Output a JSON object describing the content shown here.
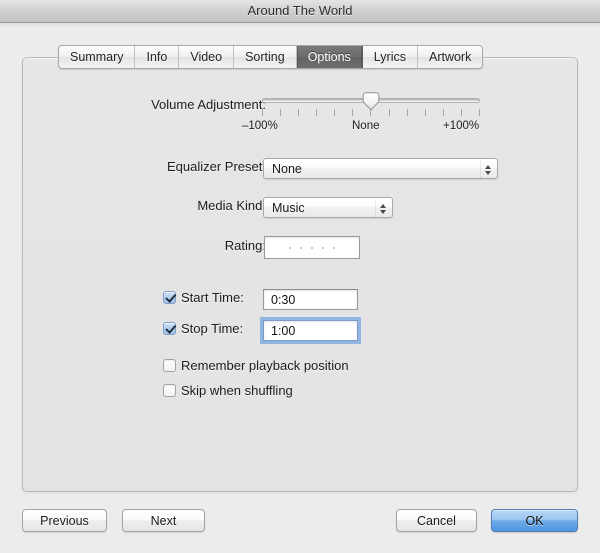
{
  "window": {
    "title": "Around The World"
  },
  "tabs": [
    {
      "label": "Summary",
      "selected": false
    },
    {
      "label": "Info",
      "selected": false
    },
    {
      "label": "Video",
      "selected": false
    },
    {
      "label": "Sorting",
      "selected": false
    },
    {
      "label": "Options",
      "selected": true
    },
    {
      "label": "Lyrics",
      "selected": false
    },
    {
      "label": "Artwork",
      "selected": false
    }
  ],
  "form": {
    "volume": {
      "label": "Volume Adjustment:",
      "min_label": "–100%",
      "center_label": "None",
      "max_label": "+100%",
      "value_percent": 0,
      "tick_count": 13
    },
    "equalizer": {
      "label": "Equalizer Preset:",
      "value": "None"
    },
    "media_kind": {
      "label": "Media Kind:",
      "value": "Music"
    },
    "rating": {
      "label": "Rating:",
      "stars": 0,
      "star_slots": 5
    },
    "start_time": {
      "label": "Start Time:",
      "value": "0:30",
      "checked": true,
      "focused": false
    },
    "stop_time": {
      "label": "Stop Time:",
      "value": "1:00",
      "checked": true,
      "focused": true
    },
    "remember_position": {
      "label": "Remember playback position",
      "checked": false
    },
    "skip_shuffling": {
      "label": "Skip when shuffling",
      "checked": false
    }
  },
  "buttons": {
    "previous": "Previous",
    "next": "Next",
    "cancel": "Cancel",
    "ok": "OK"
  },
  "colors": {
    "accent_blue": "#4f96e2",
    "focus_ring": "#78a5e1",
    "selected_tab": "#6b6b6b",
    "panel_bg": "#e4e4e4"
  }
}
